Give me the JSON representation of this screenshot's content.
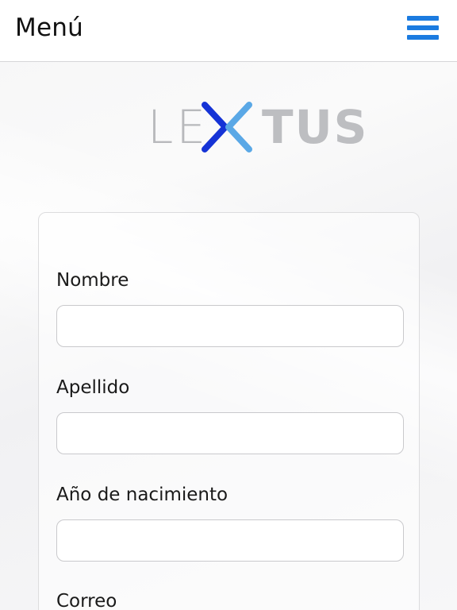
{
  "topbar": {
    "title": "Menú",
    "menu_icon": "hamburger-icon",
    "accent_color": "#1b7be0"
  },
  "logo": {
    "left_text": "LE",
    "right_text": "TUS",
    "mark_colors": [
      "#1533d6",
      "#5aa8e6"
    ]
  },
  "form": {
    "fields": [
      {
        "label": "Nombre",
        "value": "",
        "placeholder": ""
      },
      {
        "label": "Apellido",
        "value": "",
        "placeholder": ""
      },
      {
        "label": "Año de nacimiento",
        "value": "",
        "placeholder": ""
      },
      {
        "label": "Correo",
        "value": "",
        "placeholder": ""
      }
    ]
  }
}
